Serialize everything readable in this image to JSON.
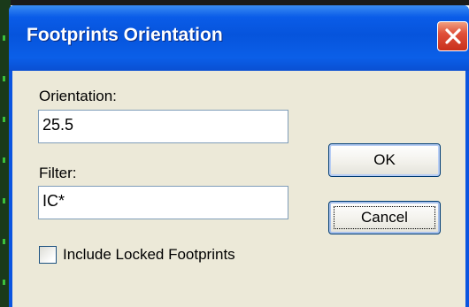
{
  "dialog": {
    "title": "Footprints Orientation",
    "close_icon": "close-icon"
  },
  "orientation": {
    "label": "Orientation:",
    "value": "25.5"
  },
  "filter": {
    "label": "Filter:",
    "value": "IC*"
  },
  "buttons": {
    "ok_label": "OK",
    "cancel_label": "Cancel"
  },
  "options": {
    "include_locked_label": "Include Locked Footprints",
    "include_locked_checked": false
  },
  "colors": {
    "titlebar": "#0654dc",
    "client_background": "#ece9d8",
    "close_button": "#e0503a"
  }
}
